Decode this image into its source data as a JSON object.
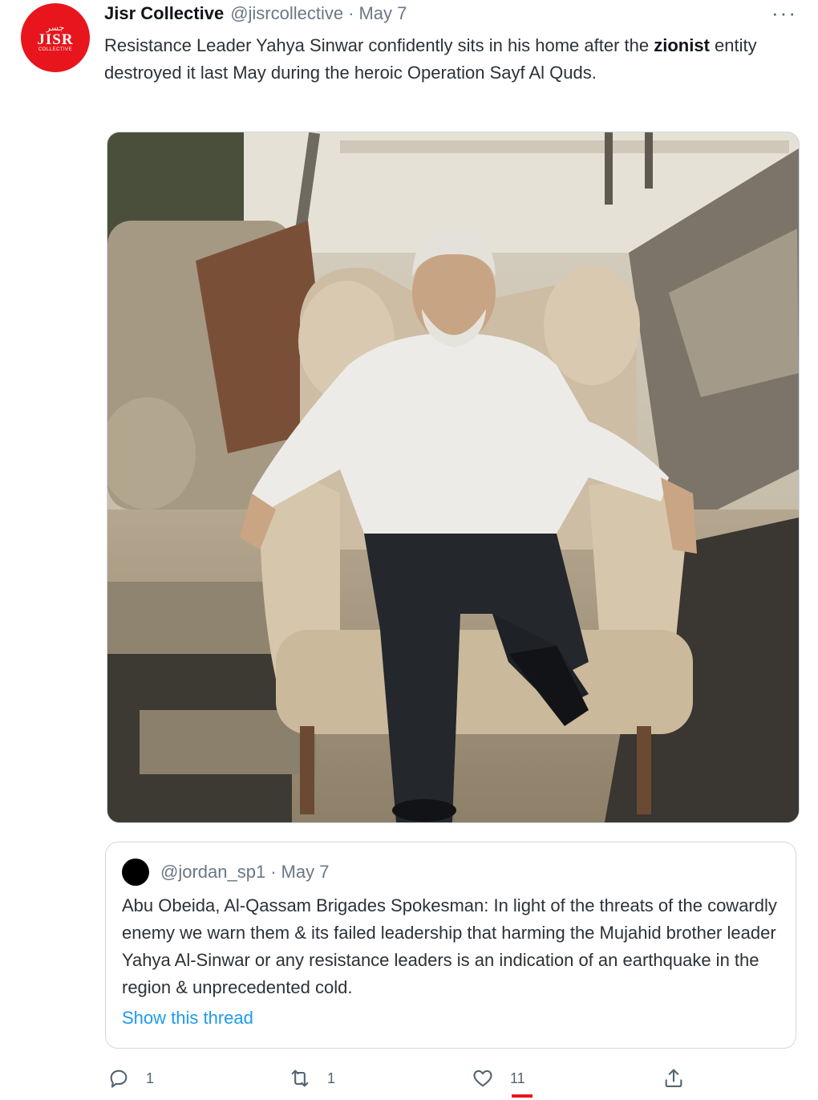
{
  "tweet": {
    "avatar_text": {
      "arabic": "جسر",
      "latin": "JISR",
      "small": "COLLECTIVE"
    },
    "author_name": "Jisr Collective",
    "handle": "@jisrcollective",
    "separator": "·",
    "date": "May 7",
    "more_label": "···",
    "text_part1": "Resistance Leader Yahya Sinwar confidently sits in his home after the ",
    "text_bold": "zionist",
    "text_part2": " entity destroyed it last May during the heroic Operation Sayf Al Quds."
  },
  "quoted_tweet": {
    "handle": "@jordan_sp1",
    "separator": "·",
    "date": "May 7",
    "text": "Abu Obeida, Al-Qassam Brigades Spokesman: In light of the threats of the cowardly enemy we warn them & its failed leadership that harming the Mujahid brother leader Yahya Al-Sinwar or any resistance leaders is an indication of an earthquake in the region & unprecedented cold.",
    "show_thread": "Show this thread"
  },
  "actions": {
    "reply": {
      "icon": "reply-icon",
      "count": "1"
    },
    "retweet": {
      "icon": "retweet-icon",
      "count": "1"
    },
    "like": {
      "icon": "heart-icon",
      "count": "11"
    },
    "share": {
      "icon": "share-icon"
    }
  },
  "colors": {
    "accent": "#1d9bf0",
    "avatar_red": "#e8151c",
    "muted": "#536471"
  }
}
